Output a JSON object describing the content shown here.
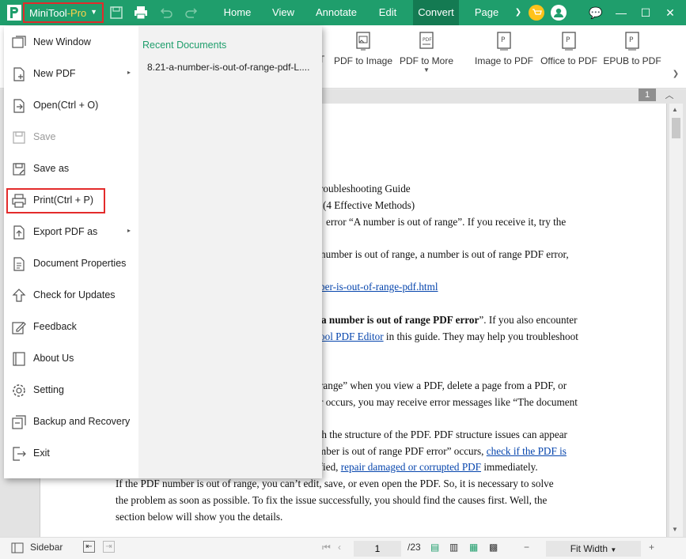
{
  "app": {
    "name": "MiniTool",
    "edition": "-Pro",
    "accent": "#1f9e6c",
    "highlight_color": "#e32b2b"
  },
  "tabs": [
    {
      "label": "Home"
    },
    {
      "label": "View"
    },
    {
      "label": "Annotate"
    },
    {
      "label": "Edit"
    },
    {
      "label": "Convert",
      "active": true
    },
    {
      "label": "Page"
    }
  ],
  "ribbon": {
    "partial_label": "T",
    "items": [
      {
        "label": "PDF to Image",
        "icon": "pdf-to-image-icon"
      },
      {
        "label": "PDF to More",
        "icon": "pdf-to-more-icon"
      },
      {
        "label": "Image to PDF",
        "icon": "image-to-pdf-icon"
      },
      {
        "label": "Office to PDF",
        "icon": "office-to-pdf-icon"
      },
      {
        "label": "EPUB to PDF",
        "icon": "epub-to-pdf-icon"
      }
    ]
  },
  "menu": {
    "items": [
      {
        "label": "New Window",
        "icon": "new-window-icon"
      },
      {
        "label": "New PDF",
        "icon": "new-pdf-icon",
        "submenu": true
      },
      {
        "label": "Open(Ctrl + O)",
        "icon": "open-icon"
      },
      {
        "label": "Save",
        "icon": "save-icon",
        "disabled": true
      },
      {
        "label": "Save as",
        "icon": "save-as-icon"
      },
      {
        "label": "Print(Ctrl + P)",
        "icon": "print-icon",
        "highlighted": true
      },
      {
        "label": "Export PDF as",
        "icon": "export-icon",
        "submenu": true
      },
      {
        "label": "Document Properties",
        "icon": "document-properties-icon"
      },
      {
        "label": "Check for Updates",
        "icon": "update-icon"
      },
      {
        "label": "Feedback",
        "icon": "feedback-icon"
      },
      {
        "label": "About Us",
        "icon": "about-icon"
      },
      {
        "label": "Setting",
        "icon": "gear-icon"
      },
      {
        "label": "Backup and Recovery",
        "icon": "backup-icon"
      },
      {
        "label": "Exit",
        "icon": "exit-icon"
      }
    ],
    "recent_title": "Recent Documents",
    "recent_items": [
      "8.21-a-number-is-out-of-range-pdf-L...."
    ]
  },
  "document": {
    "page_badge": "1",
    "lines": [
      "roubleshooting Guide",
      "t (4 Effective Methods)",
      "error “A number is out of range”. If you receive it, try the",
      "number is out of range, a number is out of range PDF error,",
      "ber-is-out-of-range-pdf.html",
      "a number is out of range PDF error",
      "”. If you also encounter",
      "ool PDF Editor",
      " in this guide. They may help you troubleshoot",
      "range” when you view a PDF, delete a page from a PDF, or",
      "r occurs, you may receive error messages like “The document",
      "ith the structure of the PDF. PDF structure issues can appear",
      "mber is out of range PDF error” occurs, ",
      "check if the PDF is",
      "ified, ",
      "repair damaged or corrupted PDF",
      " immediately.",
      "If the PDF number is out of range, you can’t edit, save, or even open the PDF. So, it is necessary to solve",
      "the problem as soon as possible. To fix the issue successfully, you should find the causes first. Well, the",
      "section below will show you the details."
    ]
  },
  "statusbar": {
    "sidebar_label": "Sidebar",
    "current_page": "1",
    "total_pages": "/23",
    "zoom": "Fit Width"
  }
}
